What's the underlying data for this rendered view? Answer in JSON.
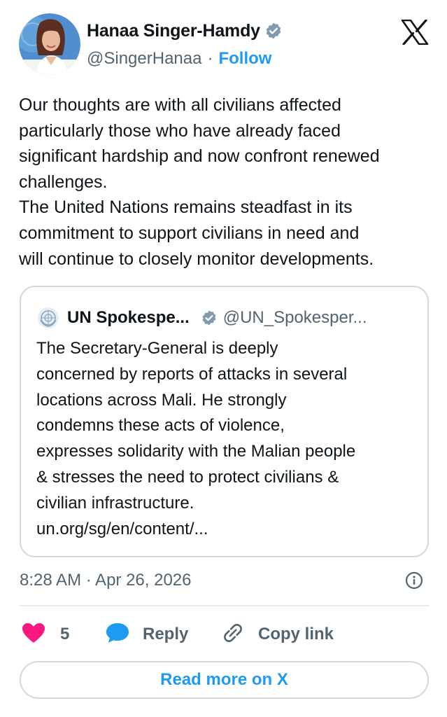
{
  "author": {
    "name": "Hanaa Singer-Hamdy",
    "handle": "@SingerHanaa",
    "separator": "·",
    "follow_label": "Follow",
    "verified_icon": "verified-badge-icon",
    "verified_color": "#829aab"
  },
  "tweet": {
    "text": "Our thoughts are with all civilians affected\nparticularly those who have already faced\nsignificant hardship and now confront renewed\nchallenges.\nThe United Nations remains steadfast in its\ncommitment to support civilians in need and\nwill continue to closely monitor developments."
  },
  "quoted_tweet": {
    "name": "UN Spokespe...",
    "handle": "@UN_Spokesper...",
    "text": "The Secretary-General is deeply\nconcerned by reports of attacks in several\nlocations across Mali. He strongly\ncondemns these acts of violence,\nexpresses solidarity with the Malian people\n&  stresses the need to protect civilians &\ncivilian infrastructure.\nun.org/sg/en/content/..."
  },
  "timestamp": "8:28 AM · Apr 26, 2026",
  "actions": {
    "like_count": "5",
    "reply_label": "Reply",
    "copy_link_label": "Copy link"
  },
  "read_more_label": "Read more on X",
  "colors": {
    "accent": "#1d9bf0",
    "like": "#f91880",
    "secondary_text": "#536471",
    "border": "#cfd9de"
  }
}
